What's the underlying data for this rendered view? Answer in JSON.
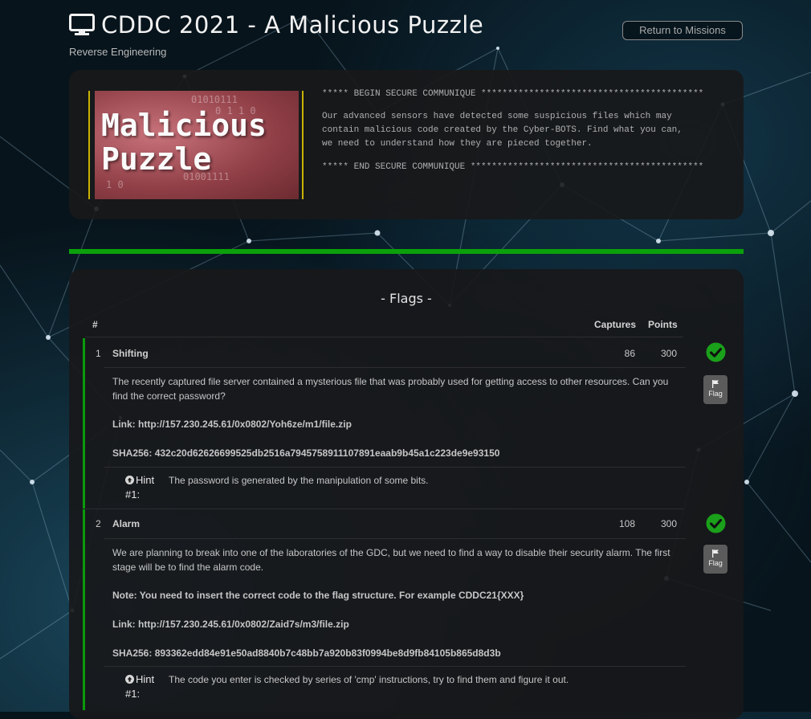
{
  "header": {
    "title": "CDDC 2021 - A Malicious Puzzle",
    "category": "Reverse Engineering",
    "return_button": "Return to Missions",
    "icon": "monitor-icon"
  },
  "briefing": {
    "banner_text_line1": "Malicious",
    "banner_text_line2": "Puzzle",
    "begin": "***** BEGIN SECURE COMMUNIQUE ******************************************",
    "body_line1": "Our advanced sensors have detected some suspicious files which may",
    "body_line2": "contain malicious code created by the Cyber-BOTS. Find what you can,",
    "body_line3": "we need to understand how they are pieced together.",
    "end": "***** END SECURE COMMUNIQUE ********************************************"
  },
  "flags": {
    "title": "- Flags -",
    "columns": {
      "num": "#",
      "captures": "Captures",
      "points": "Points"
    },
    "flag_button_label": "Flag",
    "hint_label": "Hint #1:",
    "items": [
      {
        "num": "1",
        "name": "Shifting",
        "captures": "86",
        "points": "300",
        "description": "The recently captured file server contained a mysterious file that was probably used for getting access to other resources. Can you find the correct password?",
        "link": "Link: http://157.230.245.61/0x0802/Yoh6ze/m1/file.zip",
        "sha": "SHA256: 432c20d62626699525db2516a7945758911107891eaab9b45a1c223de9e93150",
        "hint": "The password is generated by the manipulation of some bits."
      },
      {
        "num": "2",
        "name": "Alarm",
        "captures": "108",
        "points": "300",
        "description": "We are planning to break into one of the laboratories of the GDC, but we need to find a way to disable their security alarm. The first stage will be to find the alarm code.",
        "note": "Note: You need to insert the correct code to the flag structure. For example CDDC21{XXX}",
        "link": "Link:  http://157.230.245.61/0x0802/Zaid7s/m3/file.zip",
        "sha": "SHA256:  893362edd84e91e50ad8840b7c48bb7a920b83f0994be8d9fb84105b865d8d3b",
        "hint": "The code you enter is checked by series of 'cmp' instructions, try to find them and figure it out."
      }
    ]
  },
  "colors": {
    "accent_green": "#0ba00b",
    "check_green": "#1aa01a",
    "banner_border": "#c9b200"
  }
}
